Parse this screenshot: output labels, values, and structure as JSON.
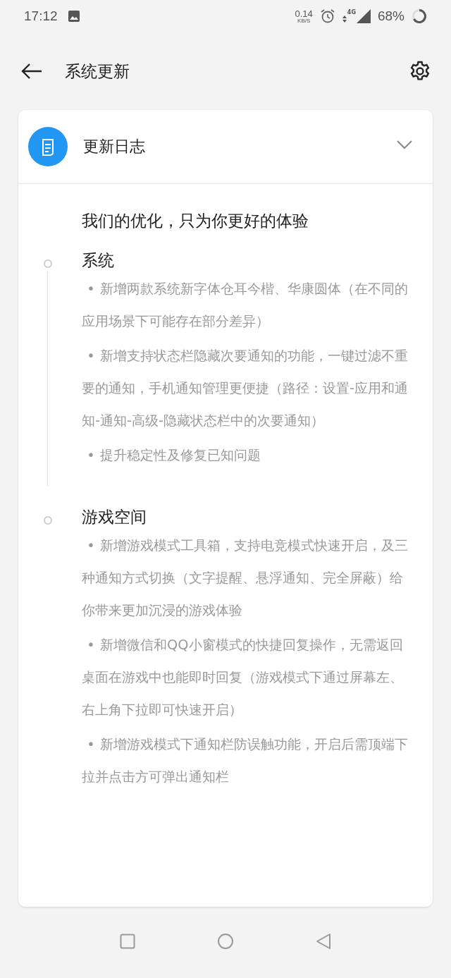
{
  "status_bar": {
    "time": "17:12",
    "net_speed": "0.14",
    "net_unit": "KB/S",
    "network": "4G",
    "battery": "68%"
  },
  "app_bar": {
    "title": "系统更新"
  },
  "card": {
    "title": "更新日志",
    "expanded": true,
    "headline": "我们的优化，只为你更好的体验",
    "sections": [
      {
        "title": "系统",
        "items": [
          {
            "bullet": "•",
            "text": "新增两款系统新字体仓耳今楷、华康圆体（在不同的应用场景下可能存在部分差异）"
          },
          {
            "bullet": "•",
            "text": "新增支持状态栏隐藏次要通知的功能，一键过滤不重要的通知，手机通知管理更便捷（路径：设置-应用和通知-通知-高级-隐藏状态栏中的次要通知）"
          },
          {
            "bullet": "•",
            "text": "提升稳定性及修复已知问题"
          }
        ]
      },
      {
        "title": "游戏空间",
        "items": [
          {
            "bullet": "•",
            "text": "新增游戏模式工具箱，支持电竞模式快速开启，及三种通知方式切换（文字提醒、悬浮通知、完全屏蔽）给你带来更加沉浸的游戏体验"
          },
          {
            "bullet": "•",
            "text": "新增微信和QQ小窗模式的快捷回复操作，无需返回桌面在游戏中也能即时回复（游戏模式下通过屏幕左、右上角下拉即可快速开启）"
          },
          {
            "bullet": "•",
            "text": "新增游戏模式下通知栏防误触功能，开启后需顶端下拉并点击方可弹出通知栏"
          }
        ]
      }
    ]
  }
}
